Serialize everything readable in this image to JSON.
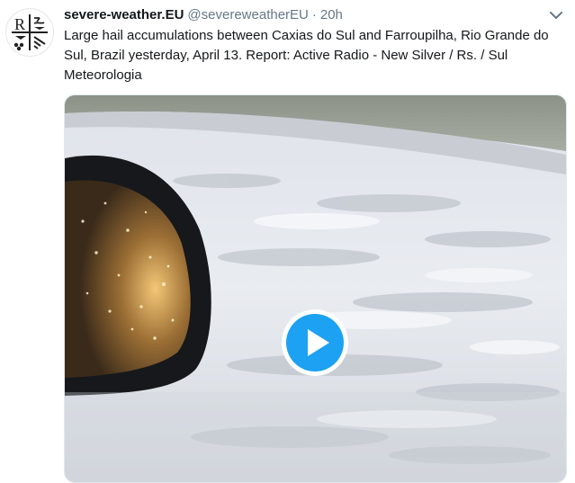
{
  "tweet": {
    "author_name": "severe-weather.EU",
    "author_handle": "@severeweatherEU",
    "separator": "·",
    "time": "20h",
    "text": "Large hail accumulations between Caxias do Sul and Farroupilha, Rio Grande do Sul, Brazil yesterday, April 13. Report: Active Radio - New Silver / Rs. / Sul Meteorologia",
    "more_icon": "chevron-down-icon"
  },
  "avatar": {
    "letter": "R"
  },
  "media": {
    "type": "video",
    "play_icon": "play-icon",
    "accent_color": "#1da1f2"
  }
}
